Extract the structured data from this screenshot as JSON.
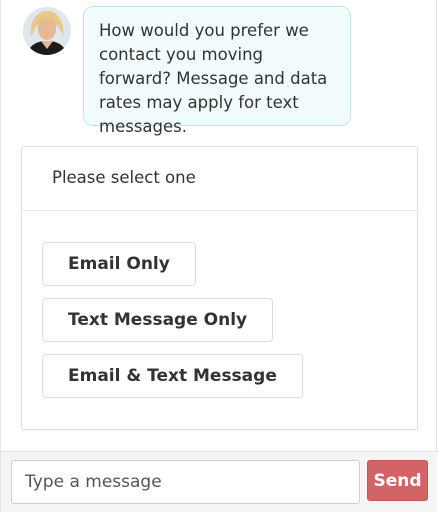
{
  "agent": {
    "avatar_icon": "agent-avatar-photo",
    "message": "How would you prefer we contact you moving forward? Message and data rates may apply for text messages."
  },
  "selection": {
    "prompt": "Please select one",
    "options": [
      {
        "label": "Email Only"
      },
      {
        "label": "Text Message Only"
      },
      {
        "label": "Email & Text Message"
      }
    ]
  },
  "composer": {
    "placeholder": "Type a message",
    "send_label": "Send"
  },
  "colors": {
    "bubble_bg": "#f2fcfc",
    "bubble_border": "#bfe7ea",
    "send_button": "#d26467"
  }
}
